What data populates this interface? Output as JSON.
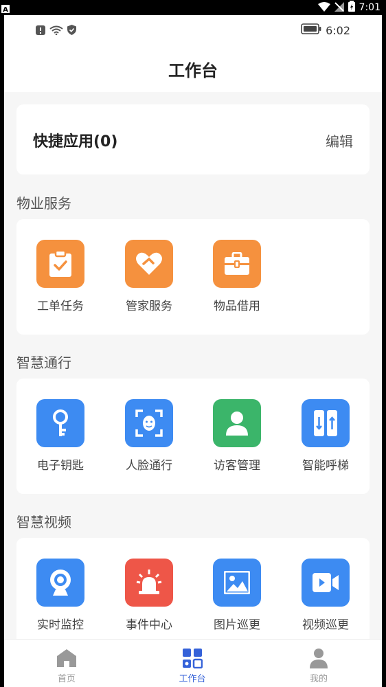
{
  "system_status": {
    "time": "7:01"
  },
  "inner_status": {
    "time": "6:02"
  },
  "header": {
    "title": "工作台"
  },
  "quick_apps": {
    "title": "快捷应用(0)",
    "edit_label": "编辑"
  },
  "sections": [
    {
      "title": "物业服务",
      "items": [
        {
          "label": "工单任务",
          "icon": "clipboard-check-icon",
          "color": "#f5913e"
        },
        {
          "label": "管家服务",
          "icon": "heart-icon",
          "color": "#f5913e"
        },
        {
          "label": "物品借用",
          "icon": "toolbox-icon",
          "color": "#f5913e"
        }
      ]
    },
    {
      "title": "智慧通行",
      "items": [
        {
          "label": "电子钥匙",
          "icon": "key-icon",
          "color": "#3d8bf2"
        },
        {
          "label": "人脸通行",
          "icon": "face-scan-icon",
          "color": "#3d8bf2"
        },
        {
          "label": "访客管理",
          "icon": "person-icon",
          "color": "#3bb56a"
        },
        {
          "label": "智能呼梯",
          "icon": "elevator-icon",
          "color": "#3d8bf2"
        }
      ]
    },
    {
      "title": "智慧视频",
      "items": [
        {
          "label": "实时监控",
          "icon": "webcam-icon",
          "color": "#3d8bf2"
        },
        {
          "label": "事件中心",
          "icon": "alarm-siren-icon",
          "color": "#ee5648"
        },
        {
          "label": "图片巡更",
          "icon": "image-icon",
          "color": "#3d8bf2"
        },
        {
          "label": "视频巡更",
          "icon": "video-camera-icon",
          "color": "#3d8bf2"
        }
      ]
    }
  ],
  "bottom_nav": {
    "items": [
      {
        "label": "首页",
        "icon": "home-icon"
      },
      {
        "label": "工作台",
        "icon": "workbench-grid-icon",
        "active": true
      },
      {
        "label": "我的",
        "icon": "profile-icon"
      }
    ],
    "active_color": "#3562d9"
  }
}
